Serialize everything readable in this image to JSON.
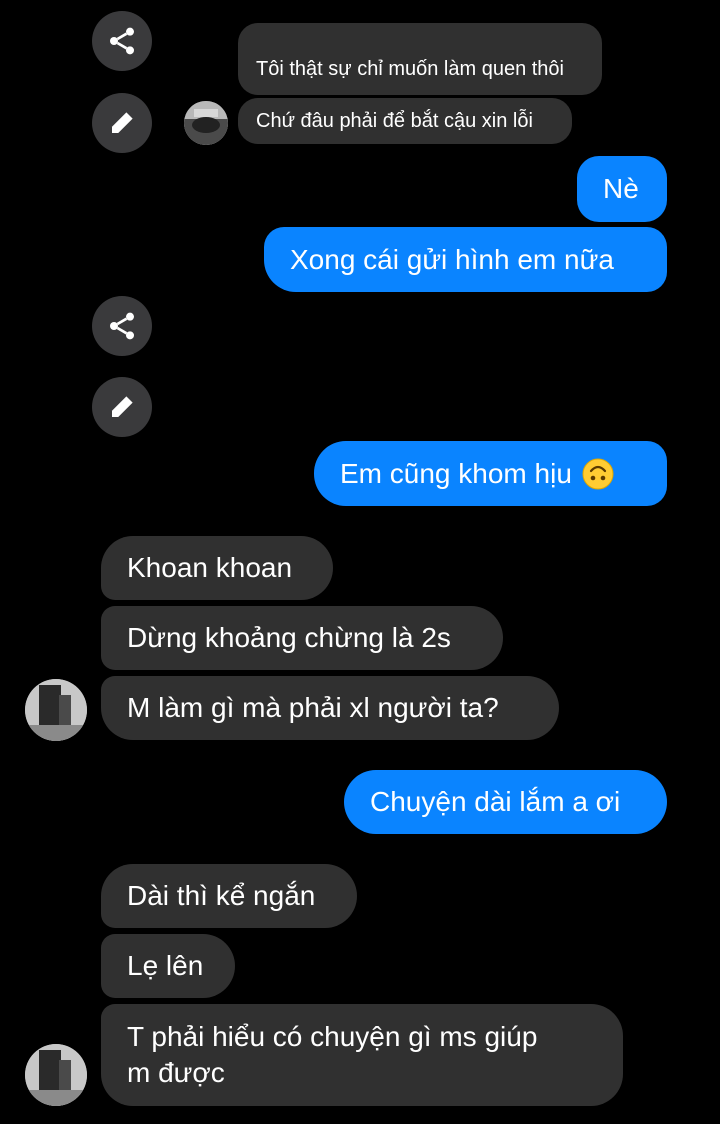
{
  "thread": {
    "messages": [
      {
        "from": "them",
        "text": "Tôi thật sự chỉ muốn làm quen thôi"
      },
      {
        "from": "them",
        "text": "Chứ đâu phải để bắt cậu xin lỗi"
      },
      {
        "from": "me",
        "text": "Nè"
      },
      {
        "from": "me",
        "text": "Xong cái gửi hình em nữa"
      },
      {
        "from": "me",
        "text": "Em cũng khom hịu",
        "emoji": "upside-down-face"
      },
      {
        "from": "them",
        "text": "Khoan khoan"
      },
      {
        "from": "them",
        "text": "Dừng khoảng chừng là 2s"
      },
      {
        "from": "them",
        "text": "M làm gì mà phải xl người ta?"
      },
      {
        "from": "me",
        "text": "Chuyện dài lắm a ơi"
      },
      {
        "from": "them",
        "text": "Dài thì kể ngắn"
      },
      {
        "from": "them",
        "text": "Lẹ lên"
      },
      {
        "from": "them",
        "text": "T phải hiểu có chuyện gì ms giúp m được"
      }
    ]
  },
  "actions": {
    "share_icon": "share-icon",
    "edit_icon": "pencil-icon"
  },
  "colors": {
    "background": "#000000",
    "incoming_bubble": "#303030",
    "outgoing_bubble": "#0a84ff",
    "action_button": "#3a3a3c"
  }
}
